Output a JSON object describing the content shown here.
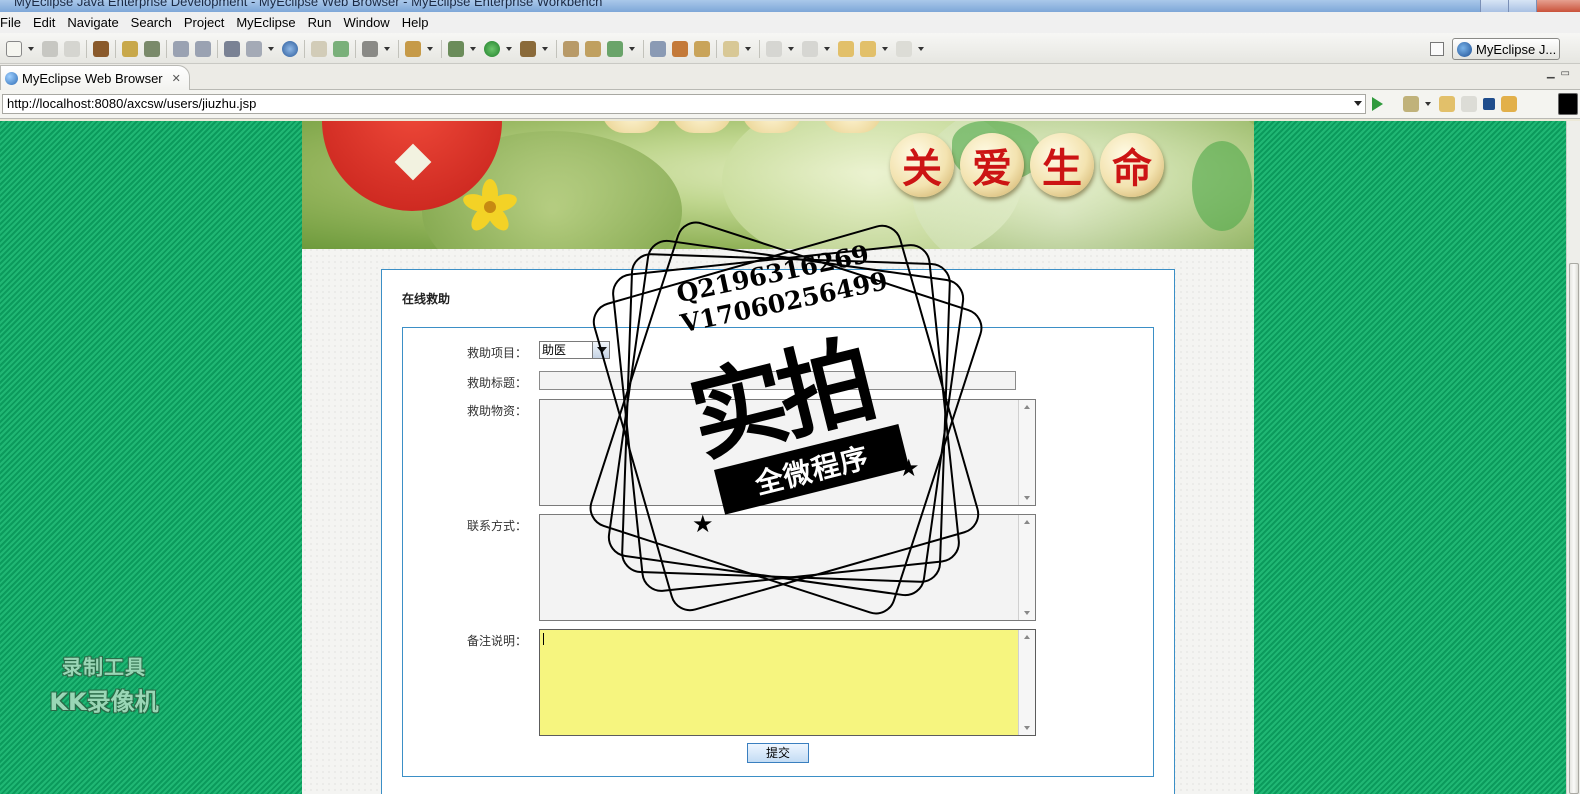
{
  "window": {
    "title": "MyEclipse Java Enterprise Development - MyEclipse Web Browser - MyEclipse Enterprise Workbench"
  },
  "menu": [
    "File",
    "Edit",
    "Navigate",
    "Search",
    "Project",
    "MyEclipse",
    "Run",
    "Window",
    "Help"
  ],
  "perspective": {
    "label": "MyEclipse J..."
  },
  "editor_tab": {
    "label": "MyEclipse Web Browser",
    "close": "✕"
  },
  "browser": {
    "url": "http://localhost:8080/axcsw/users/jiuzhu.jsp"
  },
  "banner": {
    "slogan": [
      "关",
      "爱",
      "生",
      "命"
    ]
  },
  "form": {
    "panel_title": "在线救助",
    "project_label": "救助项目：",
    "project_value": "助医",
    "title_label": "救助标题：",
    "title_value": "",
    "materials_label": "救助物资：",
    "contact_label": "联系方式：",
    "remarks_label": "备注说明：",
    "submit_label": "提交"
  },
  "watermark": {
    "qq": "Q2196316269",
    "wx": "V17060256499",
    "main": "实拍",
    "ribbon": "全微程序"
  },
  "recorder_logo": {
    "line1": "录制工具",
    "line2": "KK录像机"
  },
  "colors": {
    "background_stripe": "#20b774",
    "panel_border": "#3b8fc6",
    "active_textarea": "#f6f57f",
    "slogan_red": "#cc1414"
  }
}
